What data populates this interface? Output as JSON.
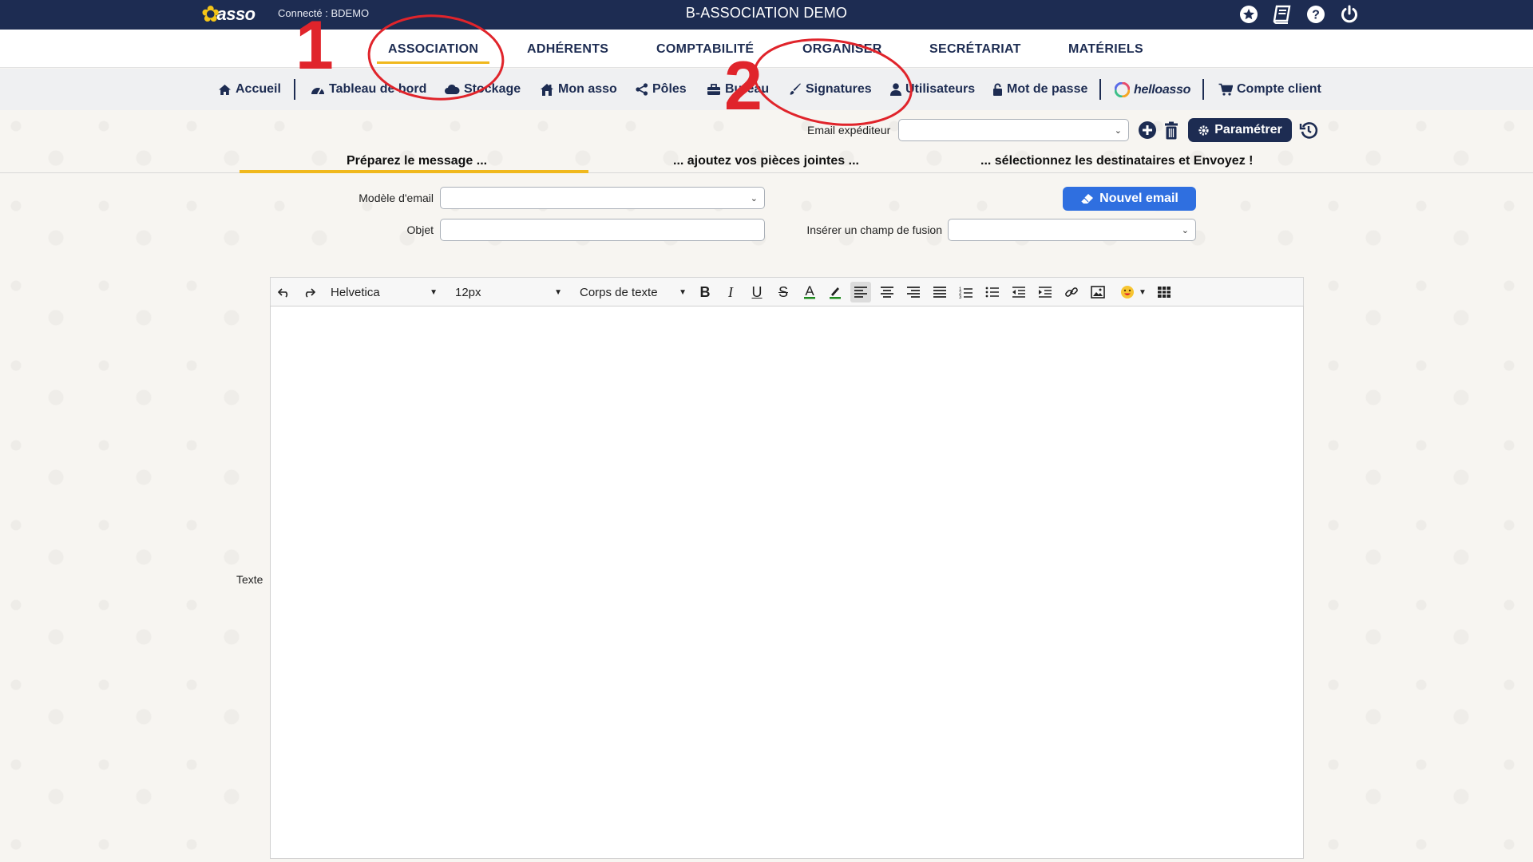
{
  "header": {
    "logo_text": "asso",
    "connected": "Connecté : BDEMO",
    "app_title": "B-ASSOCIATION DEMO",
    "icons": [
      "star-icon",
      "book-icon",
      "help-icon",
      "power-icon"
    ]
  },
  "main_menu": [
    {
      "label": "ASSOCIATION",
      "active": true
    },
    {
      "label": "ADHÉRENTS"
    },
    {
      "label": "COMPTABILITÉ"
    },
    {
      "label": "ORGANISER"
    },
    {
      "label": "SECRÉTARIAT"
    },
    {
      "label": "MATÉRIELS"
    }
  ],
  "sub_menu": [
    {
      "label": "Accueil",
      "icon": "home-icon"
    },
    {
      "label": "Tableau de bord",
      "icon": "dashboard-icon"
    },
    {
      "label": "Stockage",
      "icon": "cloud-icon"
    },
    {
      "label": "Mon asso",
      "icon": "house-icon"
    },
    {
      "label": "Pôles",
      "icon": "share-icon"
    },
    {
      "label": "Bureau",
      "icon": "briefcase-icon"
    },
    {
      "label": "Signatures",
      "icon": "brush-icon"
    },
    {
      "label": "Utilisateurs",
      "icon": "user-icon"
    },
    {
      "label": "Mot de passe",
      "icon": "lock-icon"
    },
    {
      "label": "helloasso",
      "icon": "helloasso-icon"
    },
    {
      "label": "Compte client",
      "icon": "cart-icon"
    }
  ],
  "annotations": {
    "one": "1",
    "two": "2",
    "color": "#e0242b"
  },
  "sender": {
    "label": "Email expéditeur",
    "value": "",
    "param_button": "Paramétrer"
  },
  "steps": {
    "step1": "Préparez le message ...",
    "step2": "... ajoutez vos pièces jointes ...",
    "step3": "... sélectionnez les destinataires et Envoyez !"
  },
  "form": {
    "template_label": "Modèle d'email",
    "template_value": "",
    "subject_label": "Objet",
    "subject_value": "",
    "merge_label": "Insérer un champ de fusion",
    "merge_value": "",
    "new_email_button": "Nouvel email",
    "text_label": "Texte"
  },
  "editor": {
    "font_family": "Helvetica",
    "font_size": "12px",
    "block_format": "Corps de texte",
    "content": ""
  },
  "colors": {
    "navy": "#1d2c52",
    "accent_yellow": "#f0b81d",
    "primary_blue": "#2f6fe0"
  }
}
